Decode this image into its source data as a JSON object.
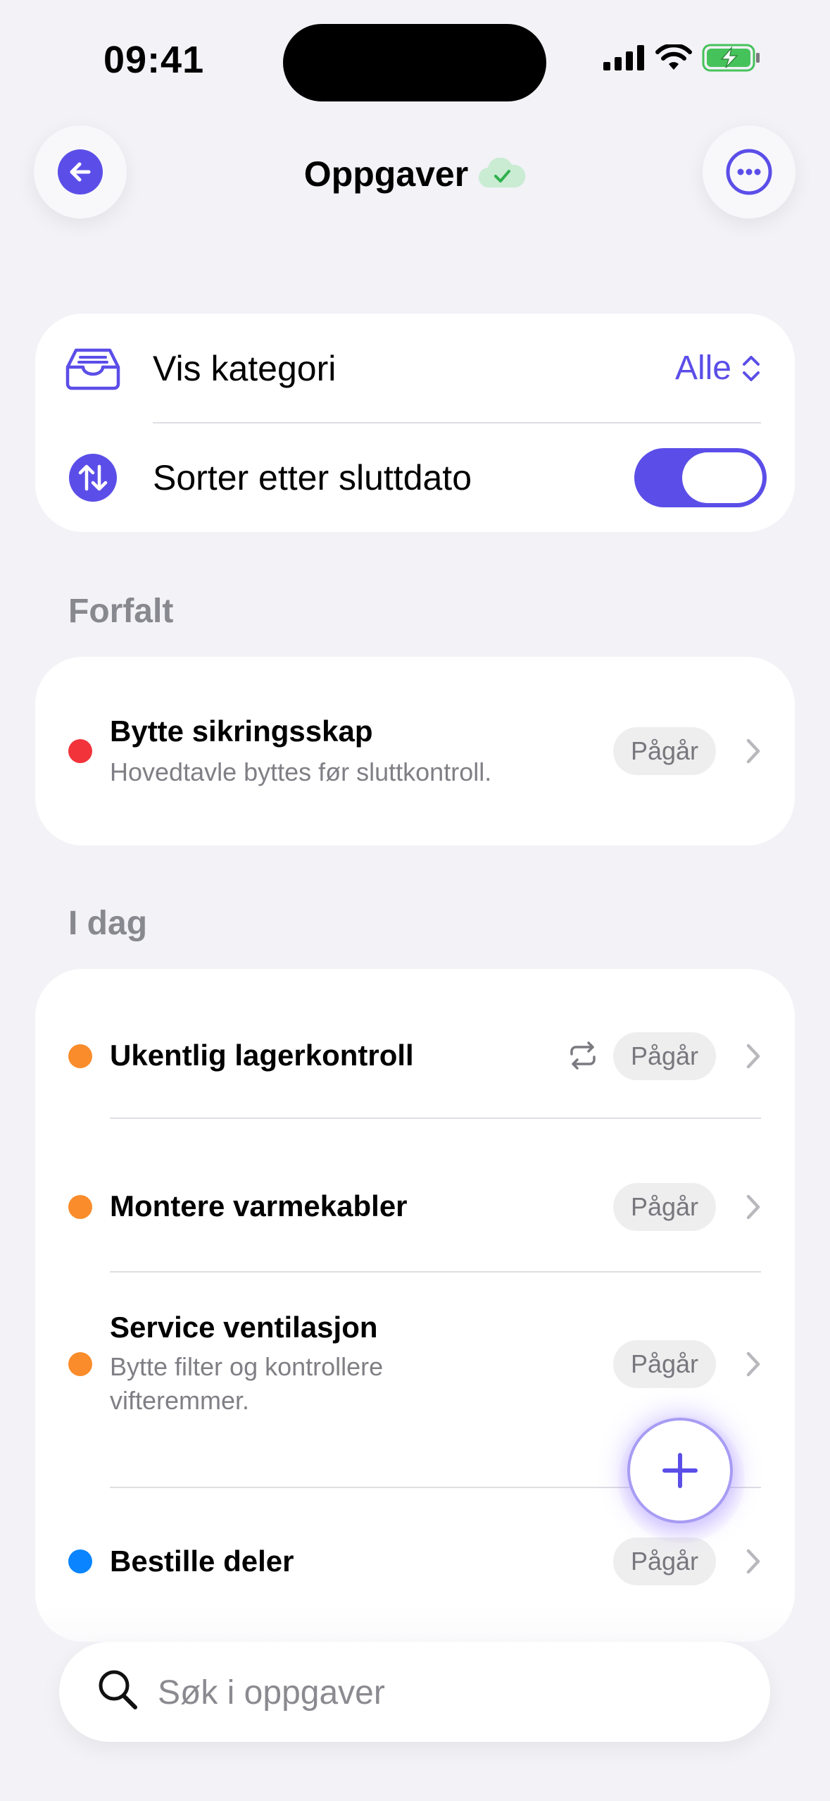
{
  "status_bar": {
    "time": "09:41"
  },
  "header": {
    "title": "Oppgaver"
  },
  "filters": {
    "category_label": "Vis kategori",
    "category_value": "Alle",
    "sort_label": "Sorter etter sluttdato",
    "sort_by_end_date": true
  },
  "sections": [
    {
      "title": "Forfalt",
      "tasks": [
        {
          "title": "Bytte sikringsskap",
          "description": "Hovedtavle byttes før sluttkontroll.",
          "status": "Pågår",
          "priority_color": "#f2333a",
          "repeating": false
        }
      ]
    },
    {
      "title": "I dag",
      "tasks": [
        {
          "title": "Ukentlig lagerkontroll",
          "description": "",
          "status": "Pågår",
          "priority_color": "#fa8c2b",
          "repeating": true
        },
        {
          "title": "Montere varmekabler",
          "description": "",
          "status": "Pågår",
          "priority_color": "#fa8c2b",
          "repeating": false
        },
        {
          "title": "Service ventilasjon",
          "description_lines": [
            "Bytte filter og kontrollere",
            "vifteremmer."
          ],
          "status": "Pågår",
          "priority_color": "#fa8c2b",
          "repeating": false
        },
        {
          "title": "Bestille deler",
          "description": "",
          "status": "Pågår",
          "priority_color": "#0a84ff",
          "repeating": false
        }
      ]
    }
  ],
  "search": {
    "placeholder": "Søk i oppgaver"
  },
  "colors": {
    "accent": "#5b4ee8",
    "background": "#f2f2f7",
    "sync_ok": "#34c759"
  },
  "icons": [
    "arrow-left-icon",
    "ellipsis-icon",
    "cloud-check-icon",
    "tray-icon",
    "sort-arrows-icon",
    "chevron-up-down-icon",
    "repeat-icon",
    "chevron-right-icon",
    "plus-icon",
    "search-icon"
  ]
}
